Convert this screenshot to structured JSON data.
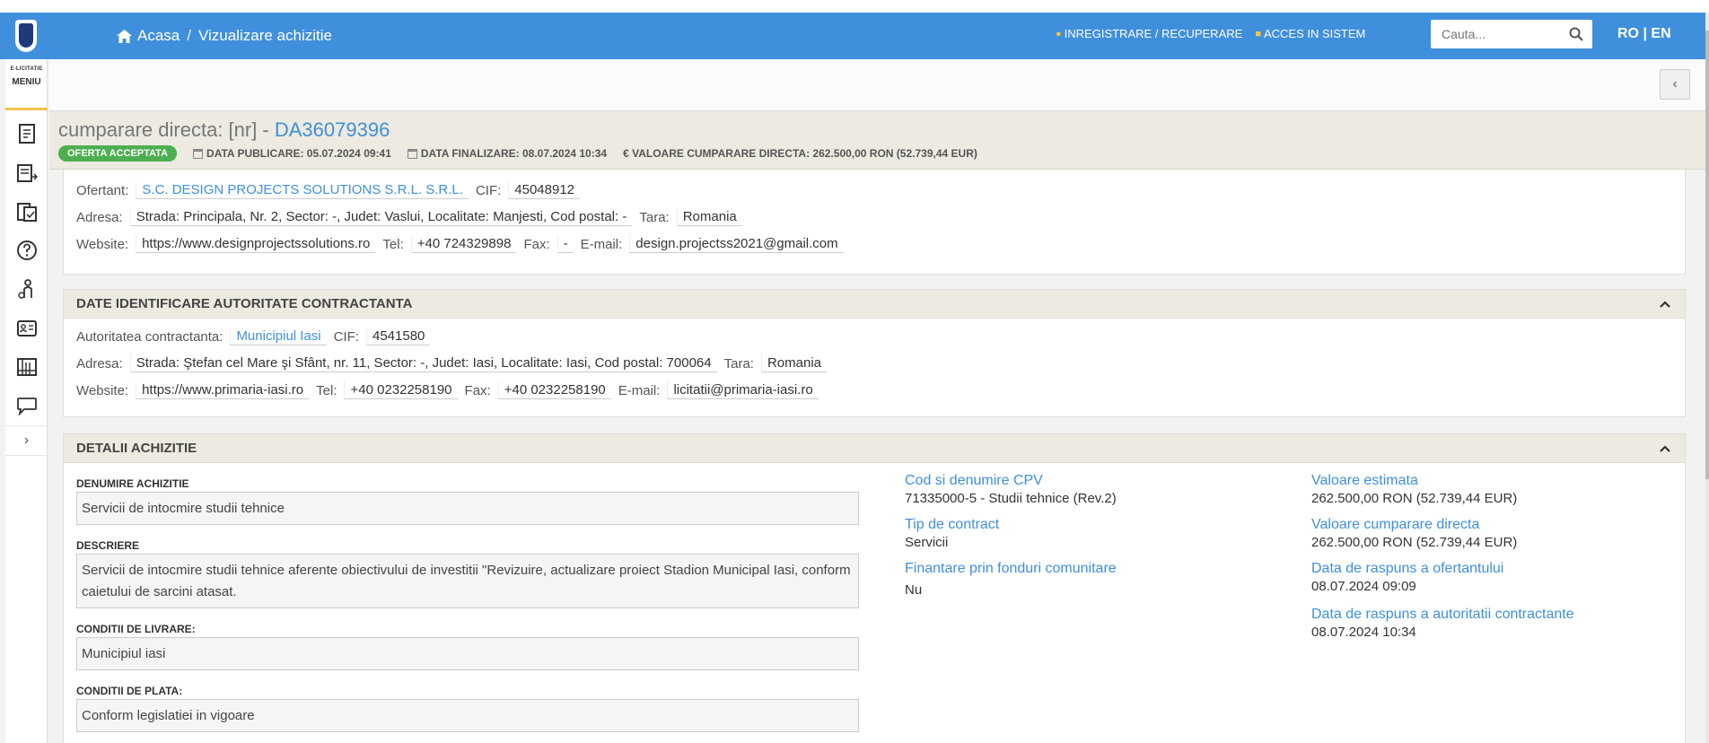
{
  "header": {
    "breadcrumb": {
      "home": "Acasa",
      "separator": "/",
      "current": "Vizualizare achizitie"
    },
    "auth": {
      "register": "INREGISTRARE / RECUPERARE",
      "login": "ACCES IN SISTEM"
    },
    "search": {
      "placeholder": "Cauta..."
    },
    "lang": {
      "ro": "RO",
      "sep": "|",
      "en": "EN"
    },
    "color": "#3f8fdc"
  },
  "sidebar": {
    "brand_small": "E-LICITATIE",
    "menu_label": "MENIU",
    "icons": [
      "document-icon",
      "list-arrow-icon",
      "clipboard-check-icon",
      "help-icon",
      "person-icon",
      "id-card-icon",
      "catalog-icon",
      "chat-icon"
    ],
    "expand": "›"
  },
  "title": {
    "prefix": "cumparare directa: [nr] - ",
    "code": "DA36079396",
    "status": "OFERTA ACCEPTATA",
    "status_color": "#4caf50",
    "published": "DATA PUBLICARE: 05.07.2024 09:41",
    "finalized": "DATA FINALIZARE: 08.07.2024 10:34",
    "value": "€ VALOARE CUMPARARE DIRECTA: 262.500,00  RON (52.739,44  EUR)"
  },
  "bidder": {
    "ofertant_label": "Ofertant:",
    "ofertant": "S.C. DESIGN PROJECTS SOLUTIONS S.R.L. S.R.L.",
    "cif_label": "CIF:",
    "cif": "45048912",
    "address_label": "Adresa:",
    "address": "Strada: Principala, Nr. 2, Sector: -, Judet: Vaslui, Localitate: Manjesti, Cod postal: -",
    "country_label": "Tara:",
    "country": "Romania",
    "website_label": "Website:",
    "website": "https://www.designprojectssolutions.ro",
    "tel_label": "Tel:",
    "tel": "+40 724329898",
    "fax_label": "Fax:",
    "fax": "-",
    "email_label": "E-mail:",
    "email": "design.projectss2021@gmail.com"
  },
  "authority": {
    "heading": "DATE IDENTIFICARE AUTORITATE CONTRACTANTA",
    "name_label": "Autoritatea contractanta:",
    "name": "Municipiul Iasi",
    "cif_label": "CIF:",
    "cif": "4541580",
    "address_label": "Adresa:",
    "address": "Strada: Ştefan cel Mare şi Sfânt, nr. 11, Sector: -, Judet: Iasi, Localitate: Iasi, Cod postal: 700064",
    "country_label": "Tara:",
    "country": "Romania",
    "website_label": "Website:",
    "website": "https://www.primaria-iasi.ro",
    "tel_label": "Tel:",
    "tel": "+40 0232258190",
    "fax_label": "Fax:",
    "fax": "+40 0232258190",
    "email_label": "E-mail:",
    "email": "licitatii@primaria-iasi.ro"
  },
  "details": {
    "heading": "DETALII ACHIZITIE",
    "name_label": "DENUMIRE ACHIZITIE",
    "name": "Servicii de intocmire studii tehnice",
    "desc_label": "DESCRIERE",
    "desc": "Servicii de intocmire studii tehnice aferente obiectivului de investitii \"Revizuire, actualizare proiect Stadion Municipal Iasi, conform caietului de sarcini atasat.",
    "delivery_label": "CONDITII DE LIVRARE:",
    "delivery": "Municipiul iasi",
    "payment_label": "CONDITII DE PLATA:",
    "payment": "Conform legislatiei in vigoare",
    "cpv_label": "Cod si denumire CPV",
    "cpv": "71335000-5 - Studii tehnice (Rev.2)",
    "contract_type_label": "Tip de contract",
    "contract_type": "Servicii",
    "eu_funds_label": "Finantare prin fonduri comunitare",
    "eu_funds": "Nu",
    "estimated_label": "Valoare estimata",
    "estimated": "262.500,00  RON (52.739,44  EUR)",
    "direct_value_label": "Valoare cumparare directa",
    "direct_value": "262.500,00  RON (52.739,44  EUR)",
    "bidder_response_label": "Data de raspuns a ofertantului",
    "bidder_response": "08.07.2024 09:09",
    "authority_response_label": "Data de raspuns a autoritatii contractante",
    "authority_response": "08.07.2024 10:34"
  }
}
